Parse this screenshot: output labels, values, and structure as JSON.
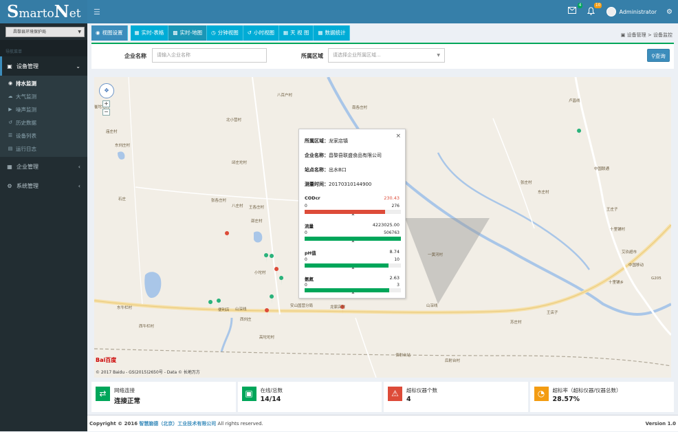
{
  "header": {
    "logo_s": "S",
    "logo_mid": "marto",
    "logo_n": "N",
    "logo_end": "et",
    "menu_icon": "hamburger-icon",
    "mail_badge": "4",
    "bell_badge": "10",
    "user_name": "Administrator",
    "colors": {
      "topbar": "#367fa9",
      "mail_badge": "#00a65a",
      "bell_badge": "#f39c12"
    }
  },
  "sidebar": {
    "org_select": "昌黎县环境保护局",
    "nav_header": "导航菜单",
    "menus": [
      {
        "label": "设备管理",
        "icon": "desktop-icon"
      },
      {
        "label": "企业管理",
        "icon": "building-icon"
      },
      {
        "label": "系统管理",
        "icon": "gear-icon"
      }
    ],
    "subitems": [
      {
        "label": "排水监测",
        "icon": "globe-icon"
      },
      {
        "label": "大气监测",
        "icon": "cloud-icon"
      },
      {
        "label": "噪声监测",
        "icon": "volume-icon"
      },
      {
        "label": "历史数据",
        "icon": "history-icon"
      },
      {
        "label": "设备列表",
        "icon": "list-icon"
      },
      {
        "label": "运行日志",
        "icon": "file-icon"
      }
    ]
  },
  "tabs": [
    {
      "label": "视图设置",
      "icon": "eye-icon"
    },
    {
      "label": "实时-表格",
      "icon": "table-icon"
    },
    {
      "label": "实时-地图",
      "icon": "map-icon"
    },
    {
      "label": "分钟视图",
      "icon": "clock-icon"
    },
    {
      "label": "小时视图",
      "icon": "history-icon"
    },
    {
      "label": "天 视 图",
      "icon": "calendar-icon"
    },
    {
      "label": "数据统计",
      "icon": "grid-icon"
    }
  ],
  "breadcrumb": {
    "part1": "设备管理",
    "sep": ">",
    "part2": "设备监控"
  },
  "filter": {
    "company_label": "企业名称",
    "company_placeholder": "请输入企业名称",
    "region_label": "所属区域",
    "region_placeholder": "请选择企业所属区域...",
    "query_button": "查询"
  },
  "map": {
    "villages": [
      "八百户村",
      "南各庄村",
      "北小营村",
      "庙庄村",
      "东刘庄村",
      "张各庄村",
      "王各庄村",
      "邵庄村",
      "卢昌线",
      "中国联通",
      "张庄村",
      "东庄村",
      "十里铺村",
      "艾玖超市",
      "中国移动",
      "十里铺乡",
      "一黄河村",
      "便利店",
      "山深线",
      "安山国营分局",
      "龙家店村",
      "山深线",
      "东牛栏村",
      "西牛栏村",
      "高坨坨村",
      "小坨村",
      "苏庄村",
      "后射台村",
      "佰射台站",
      "王店子",
      "王庄子",
      "石庄",
      "西刘庄",
      "崔坨坨村",
      "G205",
      "八庄村",
      "邱庄坨村"
    ],
    "baidu_logo": "Bai百度",
    "copyright": "© 2017 Baidu - GS(2015)2650号 - Data © 长地万方"
  },
  "popup": {
    "region_label": "所属区域：",
    "region_value": "龙家店镇",
    "company_label": "企业名称：",
    "company_value": "昌黎县联盛食品有限公司",
    "station_label": "站点名称：",
    "station_value": "出水B口",
    "time_label": "测量时间：",
    "time_value": "20170310144900",
    "metrics": [
      {
        "name": "CODcr",
        "value": "230.43",
        "min": "0",
        "max": "276",
        "level": 0.835,
        "color": "#dd4b39"
      },
      {
        "name": "流量",
        "value": "4223025.00",
        "min": "0",
        "max": "506763",
        "level": 1.0,
        "color": "#00a65a"
      },
      {
        "name": "pH值",
        "value": "8.74",
        "min": "0",
        "max": "10",
        "level": 0.874,
        "color": "#00a65a"
      },
      {
        "name": "氨氮",
        "value": "2.63",
        "min": "0",
        "max": "3",
        "level": 0.877,
        "color": "#00a65a"
      }
    ]
  },
  "stats": [
    {
      "label": "网络连接",
      "value": "连接正常",
      "icon": "exchange-icon",
      "color": "#00a65a"
    },
    {
      "label": "在线/总数",
      "value": "14/14",
      "icon": "monitor-icon",
      "color": "#00a65a"
    },
    {
      "label": "超标仪器个数",
      "value": "4",
      "icon": "warning-icon",
      "color": "#dd4b39"
    },
    {
      "label": "超标率（超标仪器/仪器总数）",
      "value": "28.57%",
      "icon": "gauge-icon",
      "color": "#f39c12"
    }
  ],
  "footer": {
    "prefix": "Copyright © 2016",
    "company": "智慧脑德（北京）工业技术有限公司",
    "suffix": "All rights reserved.",
    "version": "Version 1.0"
  }
}
